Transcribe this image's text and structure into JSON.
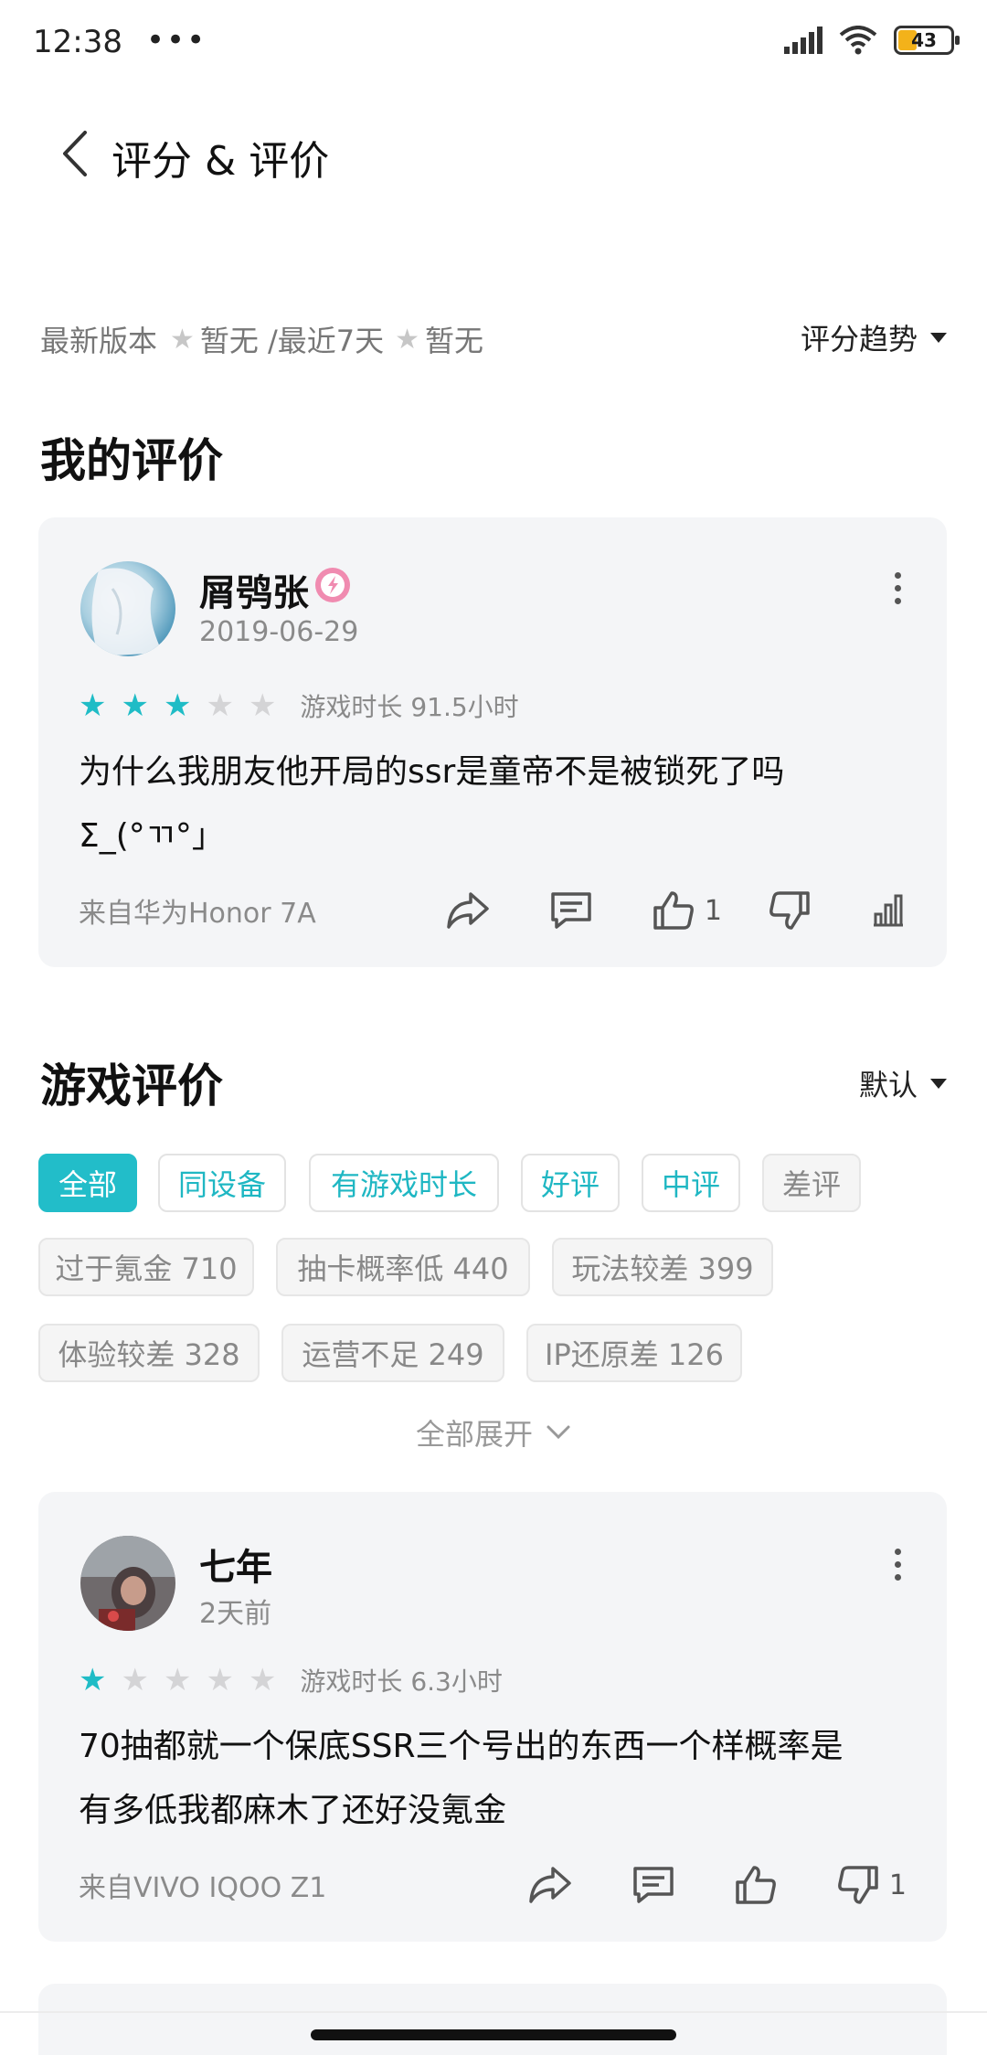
{
  "status": {
    "time": "12:38",
    "dots": "•••",
    "battery": "43"
  },
  "header": {
    "title": "评分 & 评价"
  },
  "rating_summary": {
    "latest_version_label": "最新版本",
    "latest_version_value": "暂无",
    "recent_label": "/最近7天",
    "recent_value": "暂无",
    "trend_label": "评分趋势"
  },
  "my_review_section": {
    "title": "我的评价"
  },
  "my_review": {
    "username": "屑鸮张",
    "date": "2019-06-29",
    "rating": 3,
    "play_time": "游戏时长 91.5小时",
    "text_line1": "为什么我朋友他开局的ssr是童帝不是被锁死了吗",
    "text_line2": "Σ_(°ㄲ°」",
    "source": "来自华为Honor 7A",
    "likes": "1"
  },
  "game_reviews_section": {
    "title": "游戏评价",
    "sort_label": "默认"
  },
  "filters": [
    {
      "label": "全部"
    },
    {
      "label": "同设备"
    },
    {
      "label": "有游戏时长"
    },
    {
      "label": "好评"
    },
    {
      "label": "中评"
    },
    {
      "label": "差评"
    },
    {
      "label": "过于氪金 710"
    },
    {
      "label": "抽卡概率低 440"
    },
    {
      "label": "玩法较差 399"
    },
    {
      "label": "体验较差 328"
    },
    {
      "label": "运营不足 249"
    },
    {
      "label": "IP还原差 126"
    }
  ],
  "expand_label": "全部展开",
  "review": {
    "username": "七年",
    "date": "2天前",
    "rating": 1,
    "play_time": "游戏时长 6.3小时",
    "text_line1": "70抽都就一个保底SSR三个号出的东西一个样概率是",
    "text_line2": "有多低我都麻木了还好没氪金",
    "source": "来自VIVO IQOO Z1",
    "dislikes": "1"
  }
}
